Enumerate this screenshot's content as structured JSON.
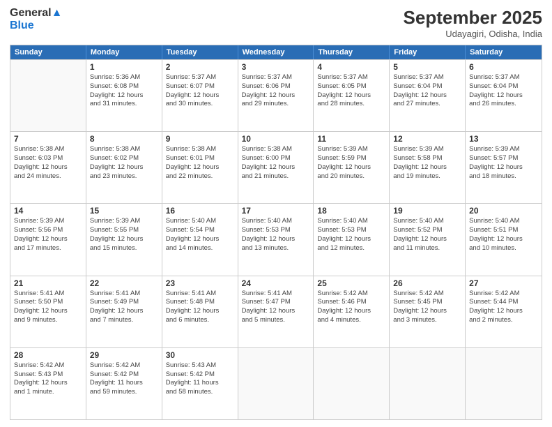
{
  "header": {
    "logo_general": "General",
    "logo_blue": "Blue",
    "month": "September 2025",
    "location": "Udayagiri, Odisha, India"
  },
  "days_of_week": [
    "Sunday",
    "Monday",
    "Tuesday",
    "Wednesday",
    "Thursday",
    "Friday",
    "Saturday"
  ],
  "weeks": [
    [
      {
        "day": "",
        "info": ""
      },
      {
        "day": "1",
        "info": "Sunrise: 5:36 AM\nSunset: 6:08 PM\nDaylight: 12 hours\nand 31 minutes."
      },
      {
        "day": "2",
        "info": "Sunrise: 5:37 AM\nSunset: 6:07 PM\nDaylight: 12 hours\nand 30 minutes."
      },
      {
        "day": "3",
        "info": "Sunrise: 5:37 AM\nSunset: 6:06 PM\nDaylight: 12 hours\nand 29 minutes."
      },
      {
        "day": "4",
        "info": "Sunrise: 5:37 AM\nSunset: 6:05 PM\nDaylight: 12 hours\nand 28 minutes."
      },
      {
        "day": "5",
        "info": "Sunrise: 5:37 AM\nSunset: 6:04 PM\nDaylight: 12 hours\nand 27 minutes."
      },
      {
        "day": "6",
        "info": "Sunrise: 5:37 AM\nSunset: 6:04 PM\nDaylight: 12 hours\nand 26 minutes."
      }
    ],
    [
      {
        "day": "7",
        "info": "Sunrise: 5:38 AM\nSunset: 6:03 PM\nDaylight: 12 hours\nand 24 minutes."
      },
      {
        "day": "8",
        "info": "Sunrise: 5:38 AM\nSunset: 6:02 PM\nDaylight: 12 hours\nand 23 minutes."
      },
      {
        "day": "9",
        "info": "Sunrise: 5:38 AM\nSunset: 6:01 PM\nDaylight: 12 hours\nand 22 minutes."
      },
      {
        "day": "10",
        "info": "Sunrise: 5:38 AM\nSunset: 6:00 PM\nDaylight: 12 hours\nand 21 minutes."
      },
      {
        "day": "11",
        "info": "Sunrise: 5:39 AM\nSunset: 5:59 PM\nDaylight: 12 hours\nand 20 minutes."
      },
      {
        "day": "12",
        "info": "Sunrise: 5:39 AM\nSunset: 5:58 PM\nDaylight: 12 hours\nand 19 minutes."
      },
      {
        "day": "13",
        "info": "Sunrise: 5:39 AM\nSunset: 5:57 PM\nDaylight: 12 hours\nand 18 minutes."
      }
    ],
    [
      {
        "day": "14",
        "info": "Sunrise: 5:39 AM\nSunset: 5:56 PM\nDaylight: 12 hours\nand 17 minutes."
      },
      {
        "day": "15",
        "info": "Sunrise: 5:39 AM\nSunset: 5:55 PM\nDaylight: 12 hours\nand 15 minutes."
      },
      {
        "day": "16",
        "info": "Sunrise: 5:40 AM\nSunset: 5:54 PM\nDaylight: 12 hours\nand 14 minutes."
      },
      {
        "day": "17",
        "info": "Sunrise: 5:40 AM\nSunset: 5:53 PM\nDaylight: 12 hours\nand 13 minutes."
      },
      {
        "day": "18",
        "info": "Sunrise: 5:40 AM\nSunset: 5:53 PM\nDaylight: 12 hours\nand 12 minutes."
      },
      {
        "day": "19",
        "info": "Sunrise: 5:40 AM\nSunset: 5:52 PM\nDaylight: 12 hours\nand 11 minutes."
      },
      {
        "day": "20",
        "info": "Sunrise: 5:40 AM\nSunset: 5:51 PM\nDaylight: 12 hours\nand 10 minutes."
      }
    ],
    [
      {
        "day": "21",
        "info": "Sunrise: 5:41 AM\nSunset: 5:50 PM\nDaylight: 12 hours\nand 9 minutes."
      },
      {
        "day": "22",
        "info": "Sunrise: 5:41 AM\nSunset: 5:49 PM\nDaylight: 12 hours\nand 7 minutes."
      },
      {
        "day": "23",
        "info": "Sunrise: 5:41 AM\nSunset: 5:48 PM\nDaylight: 12 hours\nand 6 minutes."
      },
      {
        "day": "24",
        "info": "Sunrise: 5:41 AM\nSunset: 5:47 PM\nDaylight: 12 hours\nand 5 minutes."
      },
      {
        "day": "25",
        "info": "Sunrise: 5:42 AM\nSunset: 5:46 PM\nDaylight: 12 hours\nand 4 minutes."
      },
      {
        "day": "26",
        "info": "Sunrise: 5:42 AM\nSunset: 5:45 PM\nDaylight: 12 hours\nand 3 minutes."
      },
      {
        "day": "27",
        "info": "Sunrise: 5:42 AM\nSunset: 5:44 PM\nDaylight: 12 hours\nand 2 minutes."
      }
    ],
    [
      {
        "day": "28",
        "info": "Sunrise: 5:42 AM\nSunset: 5:43 PM\nDaylight: 12 hours\nand 1 minute."
      },
      {
        "day": "29",
        "info": "Sunrise: 5:42 AM\nSunset: 5:42 PM\nDaylight: 11 hours\nand 59 minutes."
      },
      {
        "day": "30",
        "info": "Sunrise: 5:43 AM\nSunset: 5:42 PM\nDaylight: 11 hours\nand 58 minutes."
      },
      {
        "day": "",
        "info": ""
      },
      {
        "day": "",
        "info": ""
      },
      {
        "day": "",
        "info": ""
      },
      {
        "day": "",
        "info": ""
      }
    ]
  ]
}
